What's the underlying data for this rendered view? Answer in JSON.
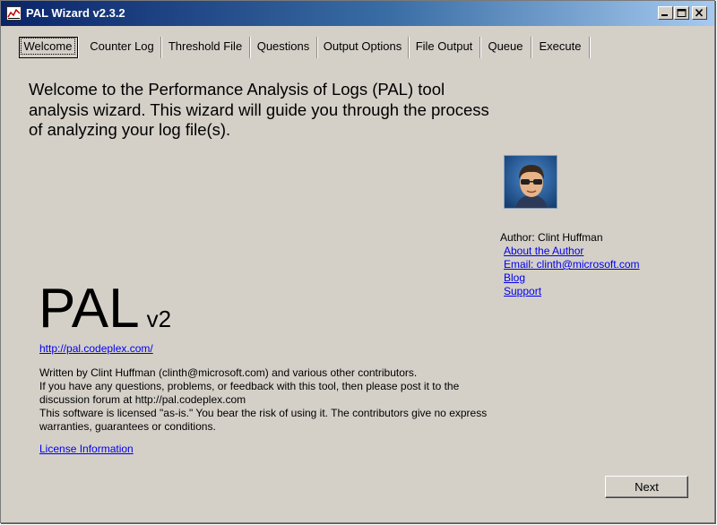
{
  "window": {
    "title": "PAL Wizard v2.3.2",
    "controls": [
      "minimize-icon",
      "maximize-icon",
      "close-icon"
    ]
  },
  "tabs": [
    {
      "label": "Welcome",
      "active": true
    },
    {
      "label": "Counter Log"
    },
    {
      "label": "Threshold File"
    },
    {
      "label": "Questions"
    },
    {
      "label": "Output Options"
    },
    {
      "label": "File Output"
    },
    {
      "label": "Queue"
    },
    {
      "label": "Execute"
    }
  ],
  "welcome": {
    "heading": "Welcome to the Performance Analysis of Logs (PAL) tool analysis wizard. This wizard will guide you through the process of analyzing your log file(s)."
  },
  "author": {
    "name": "Author: Clint Huffman",
    "links": [
      "About the Author",
      "Email: clinth@microsoft.com",
      "Blog",
      "Support"
    ]
  },
  "logo": {
    "name": "PAL",
    "version": "v2"
  },
  "site_link": "http://pal.codeplex.com/",
  "info_lines": [
    "Written by Clint Huffman (clinth@microsoft.com) and various other contributors.",
    "If you have any questions, problems, or feedback with this tool, then please post it to the",
    "discussion forum at http://pal.codeplex.com",
    "This software is licensed \"as-is.\" You bear the risk of using it. The contributors give no express",
    "warranties, guarantees or conditions."
  ],
  "license_link": "License Information",
  "next_label": "Next",
  "colors": {
    "titlebar": "#0a246a",
    "face": "#d4d0c8",
    "link": "#0000ee"
  }
}
